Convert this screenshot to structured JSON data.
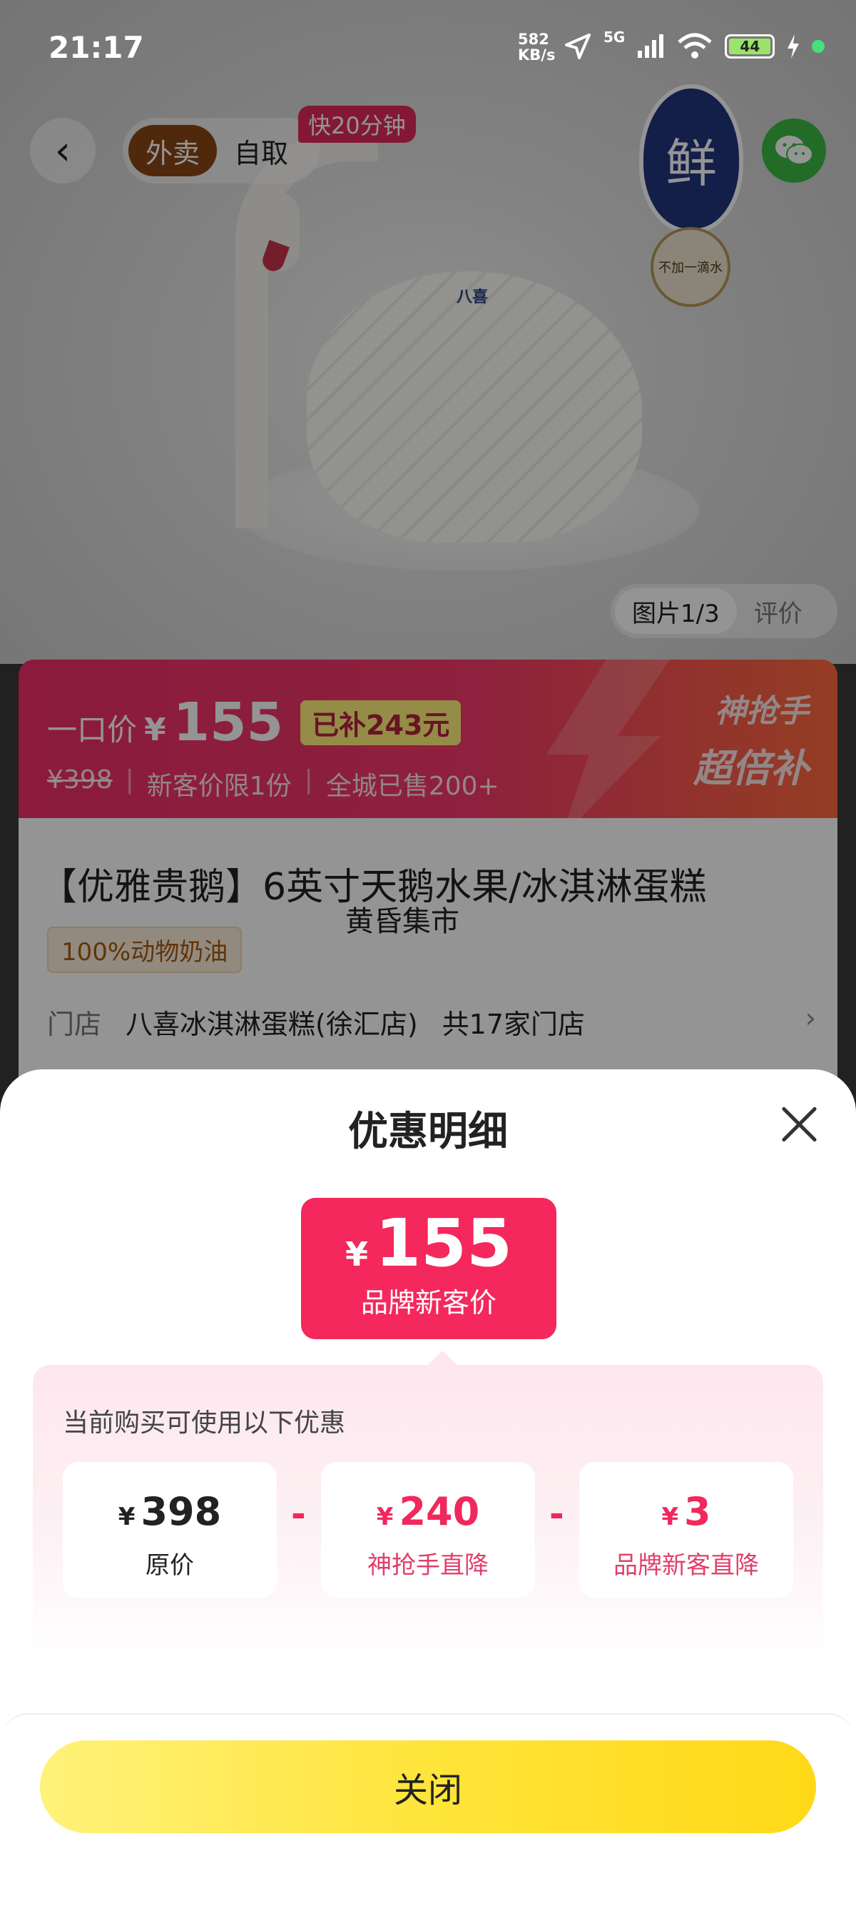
{
  "status_bar": {
    "time": "21:17",
    "speed_value": "582",
    "speed_unit": "KB/s",
    "network": "5G",
    "battery": "44"
  },
  "product_page": {
    "delivery_tabs": [
      "外卖",
      "自取"
    ],
    "fast_badge": "快20分钟",
    "fresh_badge": "鲜",
    "no_water_badge": "不加一滴水",
    "cake_label": "八喜",
    "gallery": {
      "images": "图片1/3",
      "reviews": "评价"
    },
    "banner": {
      "label": "一口价",
      "currency": "¥",
      "price": "155",
      "subsidy": "已补243元",
      "original": "¥398",
      "limit": "新客价限1份",
      "sold": "全城已售200+",
      "right_line1": "神抢手",
      "right_line2": "超倍补"
    },
    "title": "【优雅贵鹅】6英寸天鹅水果/冰淇淋蛋糕",
    "overlay_caption": "黄昏集市",
    "tag": "100%动物奶油",
    "store": {
      "label": "门店",
      "name": "八喜冰淇淋蛋糕(徐汇店)",
      "count": "共17家门店"
    }
  },
  "sheet": {
    "title": "优惠明细",
    "price_box": {
      "currency": "¥",
      "amount": "155",
      "label": "品牌新客价"
    },
    "panel_title": "当前购买可使用以下优惠",
    "items": [
      {
        "currency": "¥",
        "amount": "398",
        "label": "原价"
      },
      {
        "currency": "¥",
        "amount": "240",
        "label": "神抢手直降"
      },
      {
        "currency": "¥",
        "amount": "3",
        "label": "品牌新客直降"
      }
    ],
    "minus_sign": "-",
    "close_button": "关闭"
  },
  "colors": {
    "accent_pink": "#f4285c",
    "button_yellow": "#ffe43a",
    "brown_tab": "#8a4513"
  }
}
